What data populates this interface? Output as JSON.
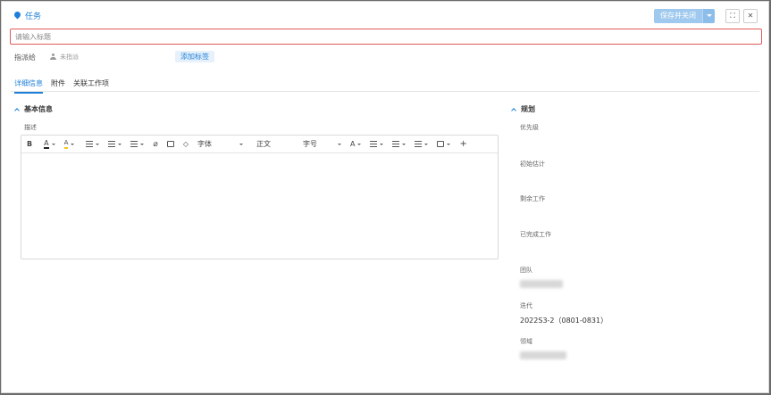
{
  "header": {
    "type_label": "任务",
    "save_button": "保存并关闭",
    "expand_icon": "⛶",
    "close_icon": "✕"
  },
  "title_input": {
    "placeholder": "请输入标题",
    "value": ""
  },
  "assign": {
    "label": "指派给",
    "assignee": "未指派",
    "add_tag": "添加标签"
  },
  "tabs": [
    {
      "label": "详细信息",
      "active": true
    },
    {
      "label": "附件",
      "active": false
    },
    {
      "label": "关联工作项",
      "active": false
    }
  ],
  "basic": {
    "section_title": "基本信息",
    "description_label": "描述",
    "toolbar": {
      "bold": "B",
      "font_color": "A",
      "highlight": "A",
      "font_family": "字体",
      "paragraph": "正文",
      "font_size": "字号",
      "superscript": "A",
      "insert": "+"
    }
  },
  "planning": {
    "section_title": "规划",
    "fields": [
      {
        "label": "优先级",
        "value": ""
      },
      {
        "label": "初始估计",
        "value": ""
      },
      {
        "label": "剩余工作",
        "value": ""
      },
      {
        "label": "已完成工作",
        "value": ""
      },
      {
        "label": "团队",
        "value": ""
      },
      {
        "label": "迭代",
        "value": "2022S3-2（0801-0831）"
      },
      {
        "label": "领域",
        "value": ""
      }
    ]
  },
  "colors": {
    "accent": "#1e7fd8",
    "error_border": "#e25a5a",
    "tag_bg": "#e6f1fb"
  }
}
